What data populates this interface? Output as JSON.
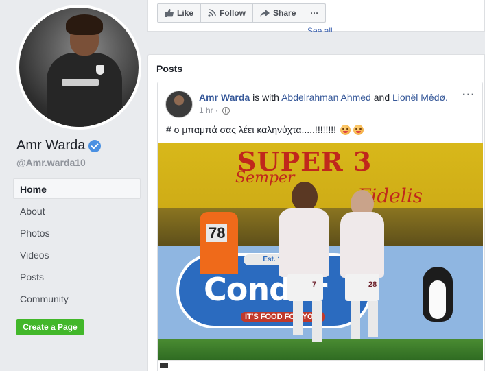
{
  "page": {
    "name": "Amr Warda",
    "handle": "@Amr.warda10"
  },
  "nav": {
    "items": [
      {
        "label": "Home",
        "active": true
      },
      {
        "label": "About"
      },
      {
        "label": "Photos"
      },
      {
        "label": "Videos"
      },
      {
        "label": "Posts"
      },
      {
        "label": "Community"
      }
    ],
    "create_page_label": "Create a Page"
  },
  "actions": {
    "like": "Like",
    "follow": "Follow",
    "share": "Share",
    "more": "···",
    "see_all": "See all"
  },
  "posts_section": {
    "title": "Posts"
  },
  "post": {
    "author": "Amr Warda",
    "is_with": "is with",
    "tag1": "Abdelrahman Ahmed",
    "and": "and",
    "tag2": "Lioněl Mêdø.",
    "time": "1 hr",
    "separator": "·",
    "text": "# ο μπαμπά σας λέει καληνύχτα.....!!!!!!!!",
    "more": "···"
  },
  "photo": {
    "banner": "SUPER 3",
    "banner_sub": "Semper",
    "banner_sub2": "Fidelis",
    "steward_number": "78",
    "ad_est": "Est. 1979",
    "ad_brand": "Condor",
    "ad_tagline": "IT'S FOOD FOR YOU!",
    "player1_number": "7",
    "player2_number": "28"
  },
  "colors": {
    "link": "#365899",
    "verified": "#4a90e2",
    "create_button": "#42b72a",
    "background": "#e9ebee"
  },
  "icons": {
    "like": "thumbs-up-icon",
    "follow": "rss-icon",
    "share": "share-arrow-icon",
    "verified": "verified-check-icon",
    "privacy": "globe-icon"
  }
}
